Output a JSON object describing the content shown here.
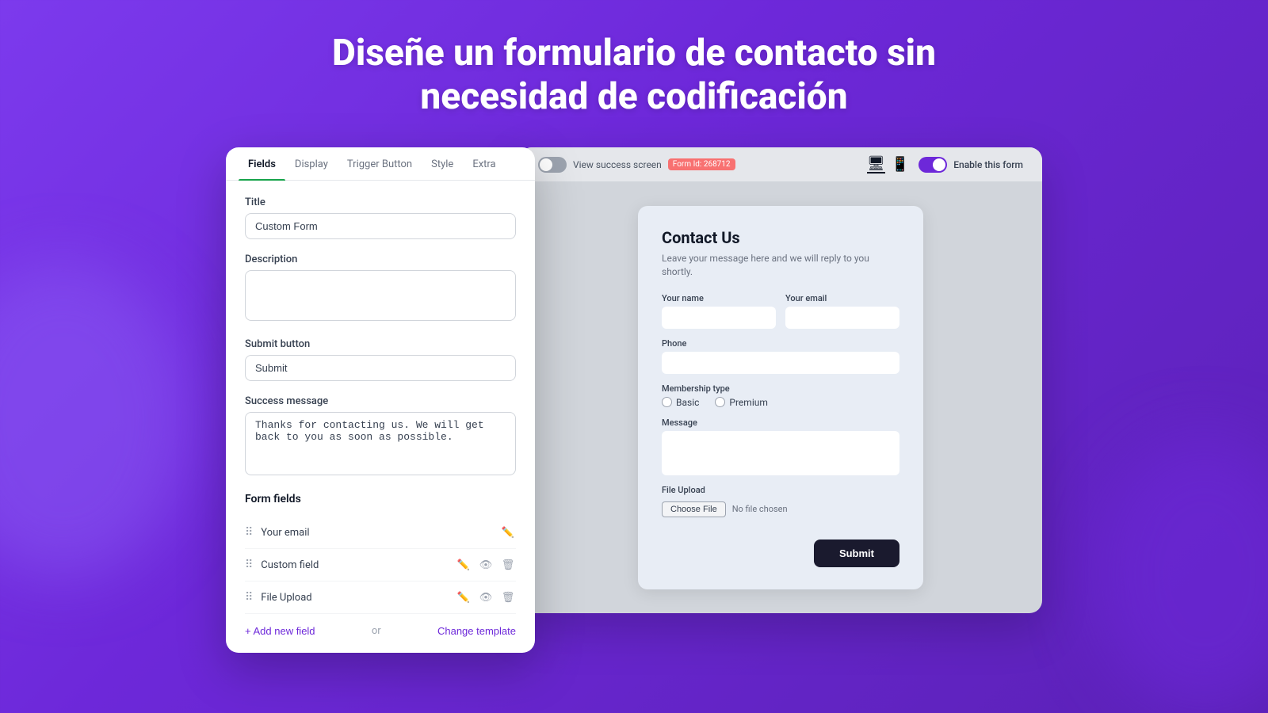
{
  "headline": {
    "line1": "Diseñe un formulario de contacto sin",
    "line2": "necesidad de codificación"
  },
  "left_panel": {
    "tabs": [
      {
        "id": "fields",
        "label": "Fields",
        "active": true
      },
      {
        "id": "display",
        "label": "Display",
        "active": false
      },
      {
        "id": "trigger",
        "label": "Trigger Button",
        "active": false
      },
      {
        "id": "style",
        "label": "Style",
        "active": false
      },
      {
        "id": "extra",
        "label": "Extra",
        "active": false
      }
    ],
    "title_label": "Title",
    "title_value": "Custom Form",
    "description_label": "Description",
    "description_value": "",
    "submit_label": "Submit button",
    "submit_value": "Submit",
    "success_label": "Success message",
    "success_value": "Thanks for contacting us. We will get back to you as soon as possible.",
    "form_fields_title": "Form fields",
    "fields": [
      {
        "name": "Your email",
        "edit_only": true
      },
      {
        "name": "Custom field",
        "edit_only": false
      },
      {
        "name": "File Upload",
        "edit_only": false
      }
    ],
    "add_field_label": "+ Add new field",
    "or_label": "or",
    "change_template_label": "Change template"
  },
  "right_panel": {
    "view_success_label": "View success screen",
    "form_id_badge": "Form Id: 268712",
    "enable_label": "Enable this form",
    "contact_form": {
      "title": "Contact Us",
      "description": "Leave your message here and we will reply to you shortly.",
      "your_name_label": "Your name",
      "your_email_label": "Your email",
      "phone_label": "Phone",
      "membership_label": "Membership type",
      "membership_options": [
        "Basic",
        "Premium"
      ],
      "message_label": "Message",
      "file_upload_label": "File Upload",
      "choose_file_label": "Choose File",
      "no_file_label": "No file chosen",
      "submit_label": "Submit"
    }
  }
}
